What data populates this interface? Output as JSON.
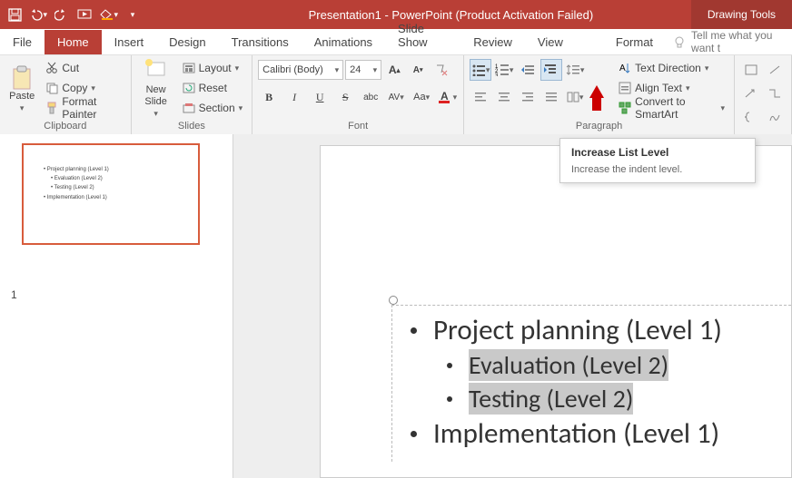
{
  "title": "Presentation1 - PowerPoint (Product Activation Failed)",
  "context_tab": "Drawing Tools",
  "menu": {
    "file": "File",
    "home": "Home",
    "insert": "Insert",
    "design": "Design",
    "transitions": "Transitions",
    "animations": "Animations",
    "slideshow": "Slide Show",
    "review": "Review",
    "view": "View",
    "format": "Format",
    "tellme": "Tell me what you want t"
  },
  "clipboard": {
    "paste": "Paste",
    "cut": "Cut",
    "copy": "Copy",
    "painter": "Format Painter",
    "label": "Clipboard"
  },
  "slides": {
    "new": "New\nSlide",
    "layout": "Layout",
    "reset": "Reset",
    "section": "Section",
    "label": "Slides"
  },
  "font": {
    "name": "Calibri (Body)",
    "size": "24",
    "label": "Font"
  },
  "paragraph": {
    "label": "Paragraph",
    "textdir": "Text Direction",
    "align": "Align Text",
    "smart": "Convert to SmartArt"
  },
  "tooltip": {
    "title": "Increase List Level",
    "body": "Increase the indent level."
  },
  "thumb_num": "1",
  "thumb_lines": [
    "• Project planning (Level 1)",
    "• Evaluation (Level 2)",
    "• Testing (Level 2)",
    "• Implementation (Level 1)"
  ],
  "bullets": [
    {
      "level": 1,
      "text": "Project planning (Level 1)",
      "sel": false
    },
    {
      "level": 2,
      "text": "Evaluation (Level 2)",
      "sel": true
    },
    {
      "level": 2,
      "text": "Testing (Level 2)",
      "sel": true
    },
    {
      "level": 1,
      "text": "Implementation (Level 1)",
      "sel": false
    }
  ]
}
